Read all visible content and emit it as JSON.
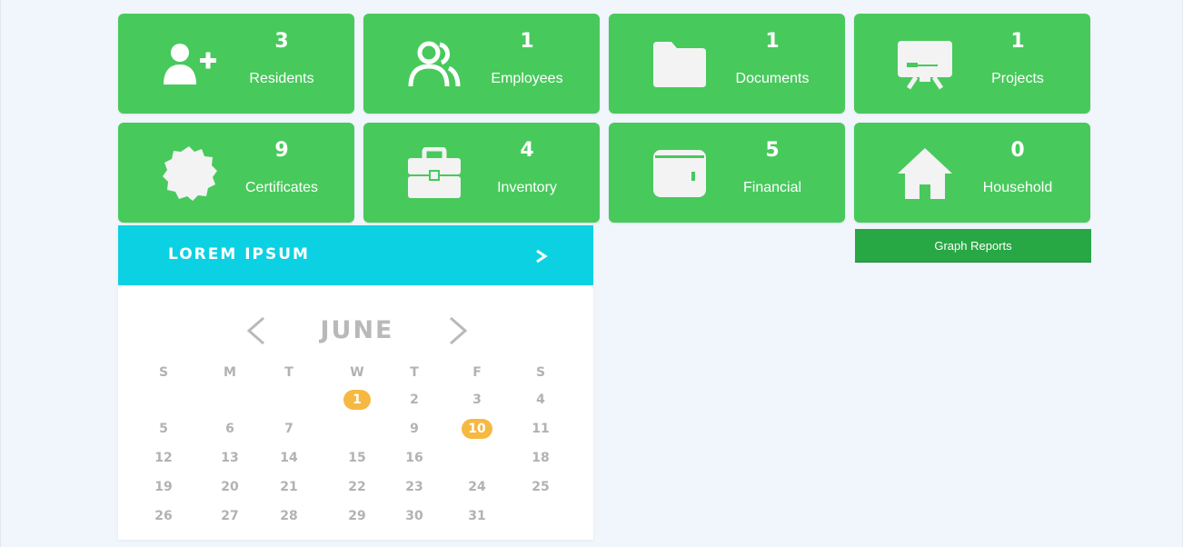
{
  "stats": [
    {
      "count": "3",
      "label": "Residents",
      "icon": "add-user-icon"
    },
    {
      "count": "1",
      "label": "Employees",
      "icon": "users-icon"
    },
    {
      "count": "1",
      "label": "Documents",
      "icon": "folder-icon"
    },
    {
      "count": "1",
      "label": "Projects",
      "icon": "presentation-board-icon"
    },
    {
      "count": "9",
      "label": "Certificates",
      "icon": "certificate-badge-icon"
    },
    {
      "count": "4",
      "label": "Inventory",
      "icon": "briefcase-icon"
    },
    {
      "count": "5",
      "label": "Financial",
      "icon": "wallet-icon"
    },
    {
      "count": "0",
      "label": "Household",
      "icon": "house-icon"
    }
  ],
  "graph_reports": {
    "label": "Graph Reports"
  },
  "calendar": {
    "header_title": "LOREM IPSUM",
    "header_next": ">",
    "month": "JUNE",
    "weekdays": [
      "S",
      "M",
      "T",
      "W",
      "T",
      "F",
      "S"
    ],
    "highlighted_days": [
      "1",
      "10"
    ],
    "weeks": [
      [
        "",
        "",
        "",
        "1",
        "2",
        "3",
        "4"
      ],
      [
        "5",
        "6",
        "7",
        "",
        "9",
        "10",
        "11"
      ],
      [
        "12",
        "13",
        "14",
        "15",
        "16",
        "",
        "18"
      ],
      [
        "19",
        "20",
        "21",
        "22",
        "23",
        "24",
        "25"
      ],
      [
        "26",
        "27",
        "28",
        "29",
        "30",
        "31",
        ""
      ]
    ]
  },
  "colors": {
    "card_green": "#48c95c",
    "button_green": "#28a745",
    "calendar_header": "#0cd1e2",
    "highlight": "#f5b942",
    "muted_text": "#b2b2b2",
    "page_bg": "#f1f5fc"
  }
}
